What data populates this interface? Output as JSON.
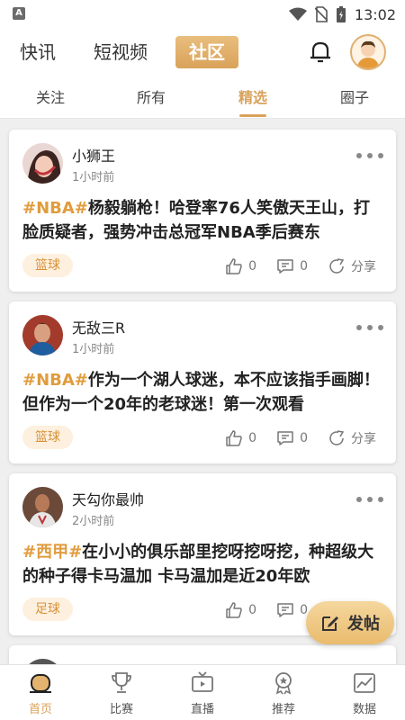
{
  "status": {
    "app_icon": "A",
    "time": "13:02"
  },
  "topnav": {
    "tabs": [
      {
        "label": "快讯"
      },
      {
        "label": "短视频"
      },
      {
        "label": "社区"
      }
    ],
    "active_tab": "社区",
    "accent": "#d9a25a"
  },
  "subtabs": [
    {
      "label": "关注"
    },
    {
      "label": "所有"
    },
    {
      "label": "精选"
    },
    {
      "label": "圈子"
    }
  ],
  "active_subtab": "精选",
  "posts": [
    {
      "user": "小狮王",
      "time": "1小时前",
      "tag": "#NBA#",
      "text": "杨毅躺枪！哈登率76人笑傲天王山，打脸质疑者，强势冲击总冠军NBA季后赛东",
      "category": "篮球",
      "likes": "0",
      "comments": "0",
      "share": "分享"
    },
    {
      "user": "无敌三R",
      "time": "1小时前",
      "tag": "#NBA#",
      "text": "作为一个湖人球迷，本不应该指手画脚！但作为一个20年的老球迷！第一次观看",
      "category": "篮球",
      "likes": "0",
      "comments": "0",
      "share": "分享"
    },
    {
      "user": "天勾你最帅",
      "time": "2小时前",
      "tag": "#西甲#",
      "text": "在小小的俱乐部里挖呀挖呀挖，种超级大的种子得卡马温加 卡马温加是近20年欧",
      "category": "足球",
      "likes": "0",
      "comments": "0",
      "share": "分享"
    }
  ],
  "fab": {
    "label": "发帖"
  },
  "bottomnav": [
    {
      "label": "首页",
      "icon": "home-icon"
    },
    {
      "label": "比赛",
      "icon": "trophy-icon"
    },
    {
      "label": "直播",
      "icon": "tv-icon"
    },
    {
      "label": "推荐",
      "icon": "medal-icon"
    },
    {
      "label": "数据",
      "icon": "chart-icon"
    }
  ],
  "active_bottom": "首页"
}
